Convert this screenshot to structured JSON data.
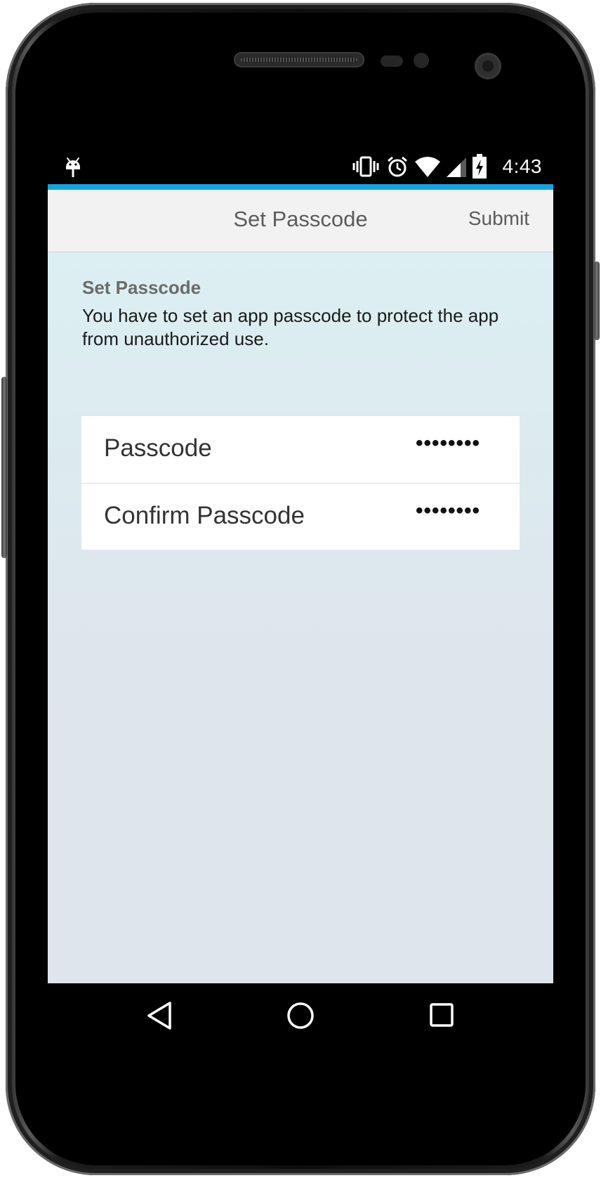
{
  "status_bar": {
    "time": "4:43",
    "icons": [
      "android-debug-icon",
      "vibrate-icon",
      "alarm-icon",
      "wifi-icon",
      "signal-icon",
      "battery-charging-icon"
    ]
  },
  "header": {
    "title": "Set Passcode",
    "submit_label": "Submit"
  },
  "intro": {
    "title": "Set Passcode",
    "text": "You have to set an app passcode to protect the app from unauthorized use."
  },
  "form": {
    "fields": [
      {
        "label": "Passcode",
        "value": "••••••••"
      },
      {
        "label": "Confirm Passcode",
        "value": "••••••••"
      }
    ]
  },
  "nav": {
    "icons": [
      "back-icon",
      "home-icon",
      "recents-icon"
    ]
  },
  "colors": {
    "accent": "#16a2e0",
    "header_bg": "#f2f2f2",
    "content_bg": "#dceff2"
  }
}
